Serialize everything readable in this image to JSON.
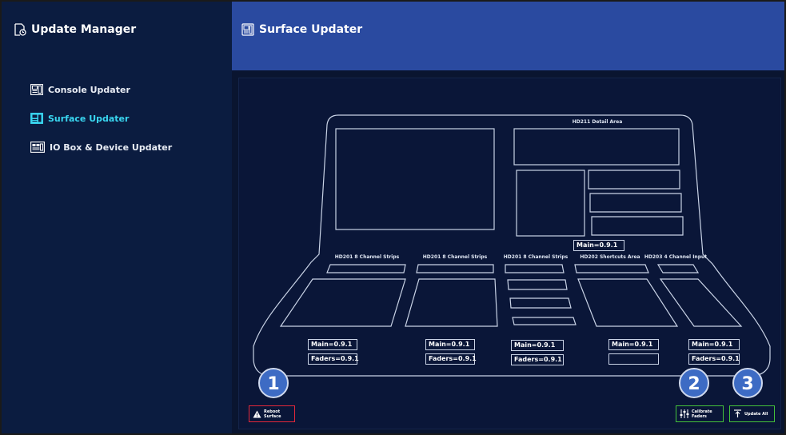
{
  "app": {
    "title": "Update Manager"
  },
  "header": {
    "title": "Surface Updater"
  },
  "sidebar": {
    "items": [
      {
        "label": "Console Updater",
        "active": false
      },
      {
        "label": "Surface Updater",
        "active": true
      },
      {
        "label": "IO Box & Device Updater",
        "active": false
      }
    ]
  },
  "surface": {
    "labels": {
      "detail_area": "HD211 Detail Area",
      "strip1": "HD201 8 Channel Strips",
      "strip2": "HD201 8 Channel Strips",
      "strip3": "HD201 8 Channel Strips",
      "shortcuts": "HD202 Shortcuts Area",
      "input4": "HD203 4 Channel Input"
    },
    "versions": {
      "detail_main": "Main=0.9.1",
      "s1_main": "Main=0.9.1",
      "s1_faders": "Faders=0.9.1",
      "s2_main": "Main=0.9.1",
      "s2_faders": "Faders=0.9.1",
      "s3_main": "Main=0.9.1",
      "s3_faders": "Faders=0.9.1",
      "shortcuts_main": "Main=0.9.1",
      "shortcuts_faders": "",
      "input_main": "Main=0.9.1",
      "input_faders": "Faders=0.9.1"
    }
  },
  "actions": {
    "reboot_label_1": "Reboot",
    "reboot_label_2": "Surface",
    "calibrate_label_1": "Calibrate",
    "calibrate_label_2": "Faders",
    "update_all_label": "Update All"
  },
  "badges": {
    "one": "1",
    "two": "2",
    "three": "3"
  },
  "colors": {
    "accent": "#39d6f0",
    "header_blue": "#2a4aa0",
    "reboot_red": "#e3273a",
    "action_green": "#44c23a",
    "badge_blue": "#3d6bc4"
  }
}
